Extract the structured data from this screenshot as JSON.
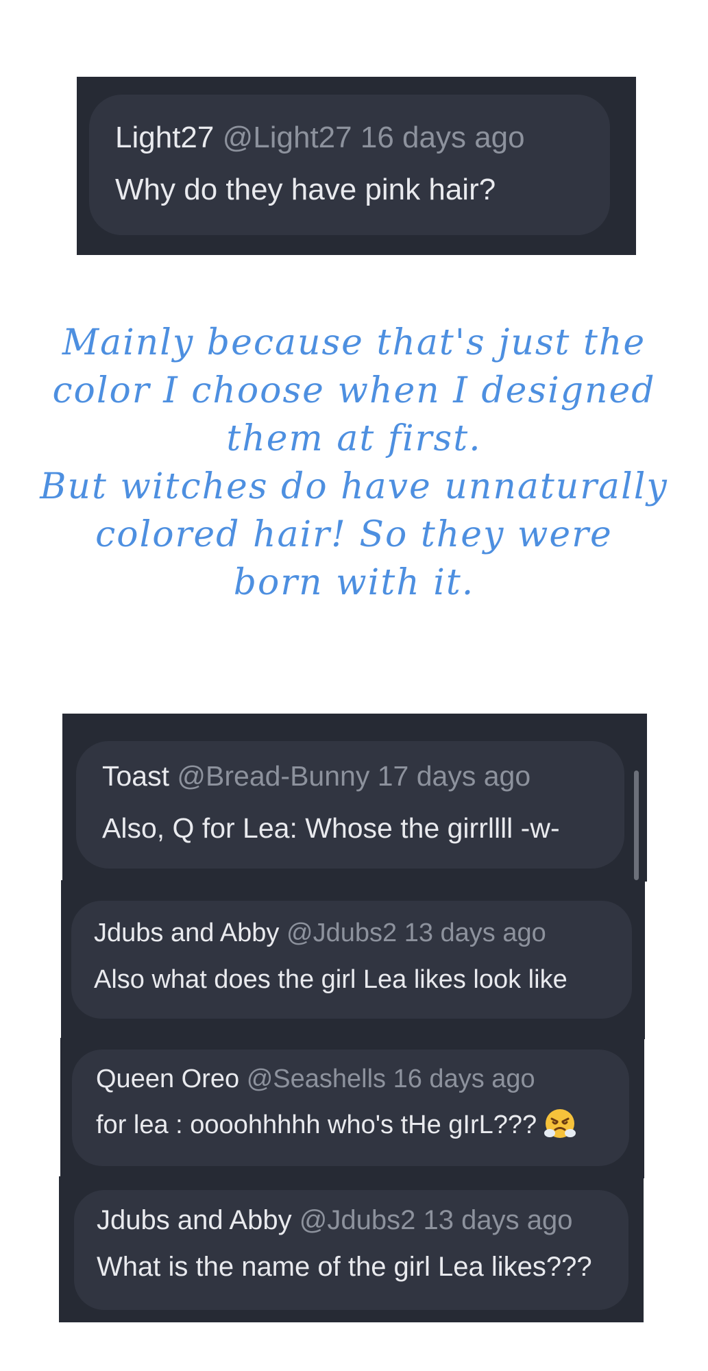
{
  "top_comment": {
    "author": "Light27",
    "handle": "@Light27",
    "time": "16 days ago",
    "text": "Why do they have pink hair?"
  },
  "reply": {
    "lines": [
      "Mainly because that's just the",
      "color I choose when I designed",
      "them at first.",
      "But witches do have unnaturally",
      "colored hair! So they were",
      "born with it."
    ],
    "color": "#4d8fe0"
  },
  "comments": [
    {
      "author": "Toast",
      "handle": "@Bread-Bunny",
      "time": "17 days ago",
      "text": "Also, Q for Lea: Whose the girrllll -w-"
    },
    {
      "author": "Jdubs and Abby",
      "handle": "@Jdubs2",
      "time": "13 days ago",
      "text": "Also what does the girl Lea likes look like"
    },
    {
      "author": "Queen Oreo",
      "handle": "@Seashells",
      "time": "16 days ago",
      "text": "for lea : oooohhhhh who's tHe gIrL???",
      "emoji": "angry-steam-face-icon"
    },
    {
      "author": "Jdubs and Abby",
      "handle": "@Jdubs2",
      "time": "13 days ago",
      "text": "What is the name of the girl Lea likes???"
    }
  ],
  "colors": {
    "panel": "#262a34",
    "bubble": "#313541",
    "author": "#e9eaee",
    "meta": "#8d929d"
  }
}
